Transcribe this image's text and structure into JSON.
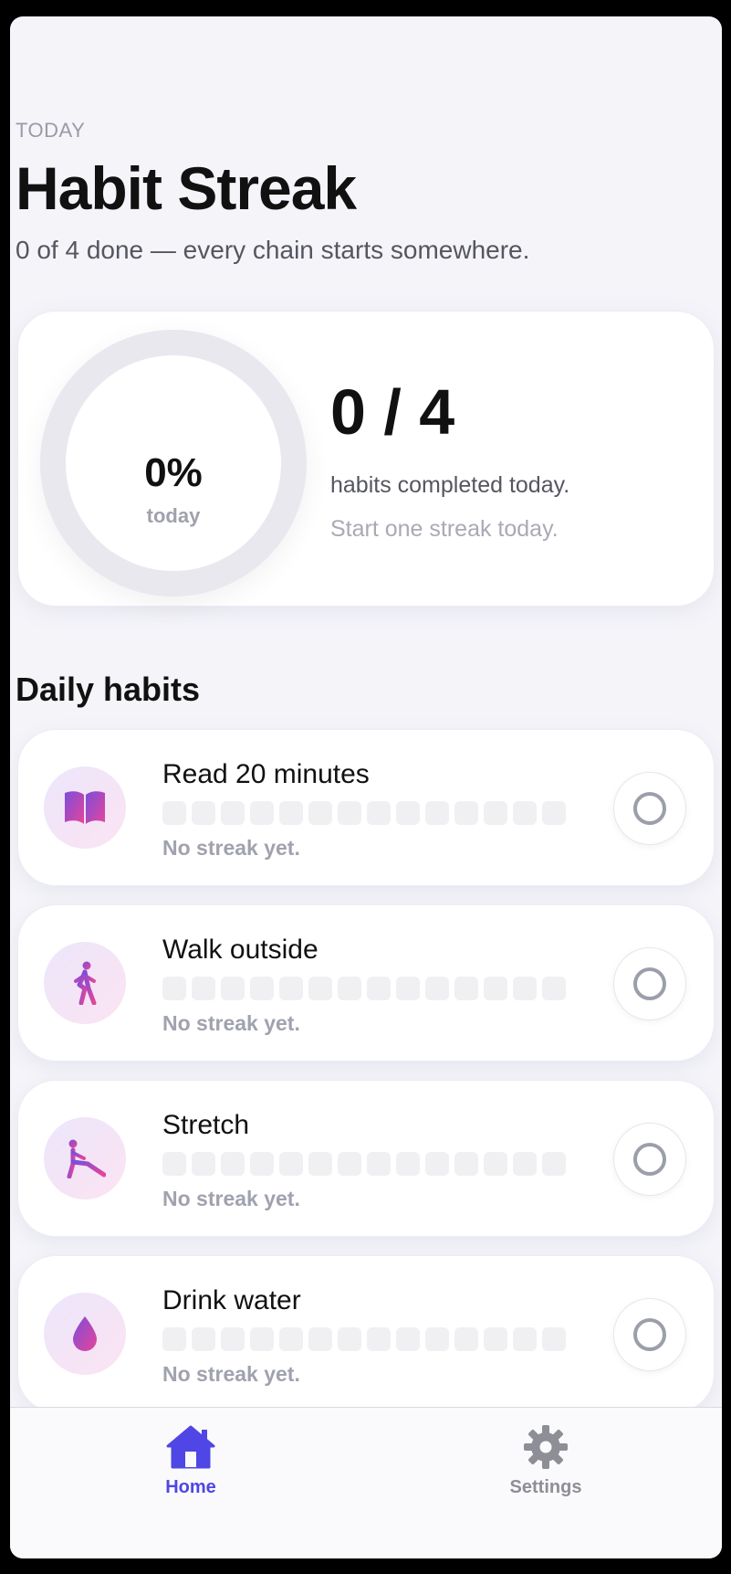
{
  "header": {
    "eyebrow": "TODAY",
    "title": "Habit Streak",
    "subtitle": "0 of 4 done — every chain starts somewhere."
  },
  "summary": {
    "percent": "0%",
    "percent_label": "today",
    "count": "0 / 4",
    "caption": "habits completed today.",
    "hint": "Start one streak today.",
    "progress_fraction": 0
  },
  "section_title": "Daily habits",
  "habits": [
    {
      "name": "Read 20 minutes",
      "icon": "book-icon",
      "streak_text": "No streak yet.",
      "done": false
    },
    {
      "name": "Walk outside",
      "icon": "walking-icon",
      "streak_text": "No streak yet.",
      "done": false
    },
    {
      "name": "Stretch",
      "icon": "stretch-icon",
      "streak_text": "No streak yet.",
      "done": false
    },
    {
      "name": "Drink water",
      "icon": "water-drop-icon",
      "streak_text": "No streak yet.",
      "done": false
    }
  ],
  "tabs": {
    "home": {
      "label": "Home",
      "icon": "home-icon",
      "active": true
    },
    "settings": {
      "label": "Settings",
      "icon": "gear-icon",
      "active": false
    }
  },
  "colors": {
    "accent": "#4f46e5",
    "inactive_tab": "#8e8e96",
    "icon_gradient_start": "#7c4ddb",
    "icon_gradient_end": "#e6459a"
  }
}
